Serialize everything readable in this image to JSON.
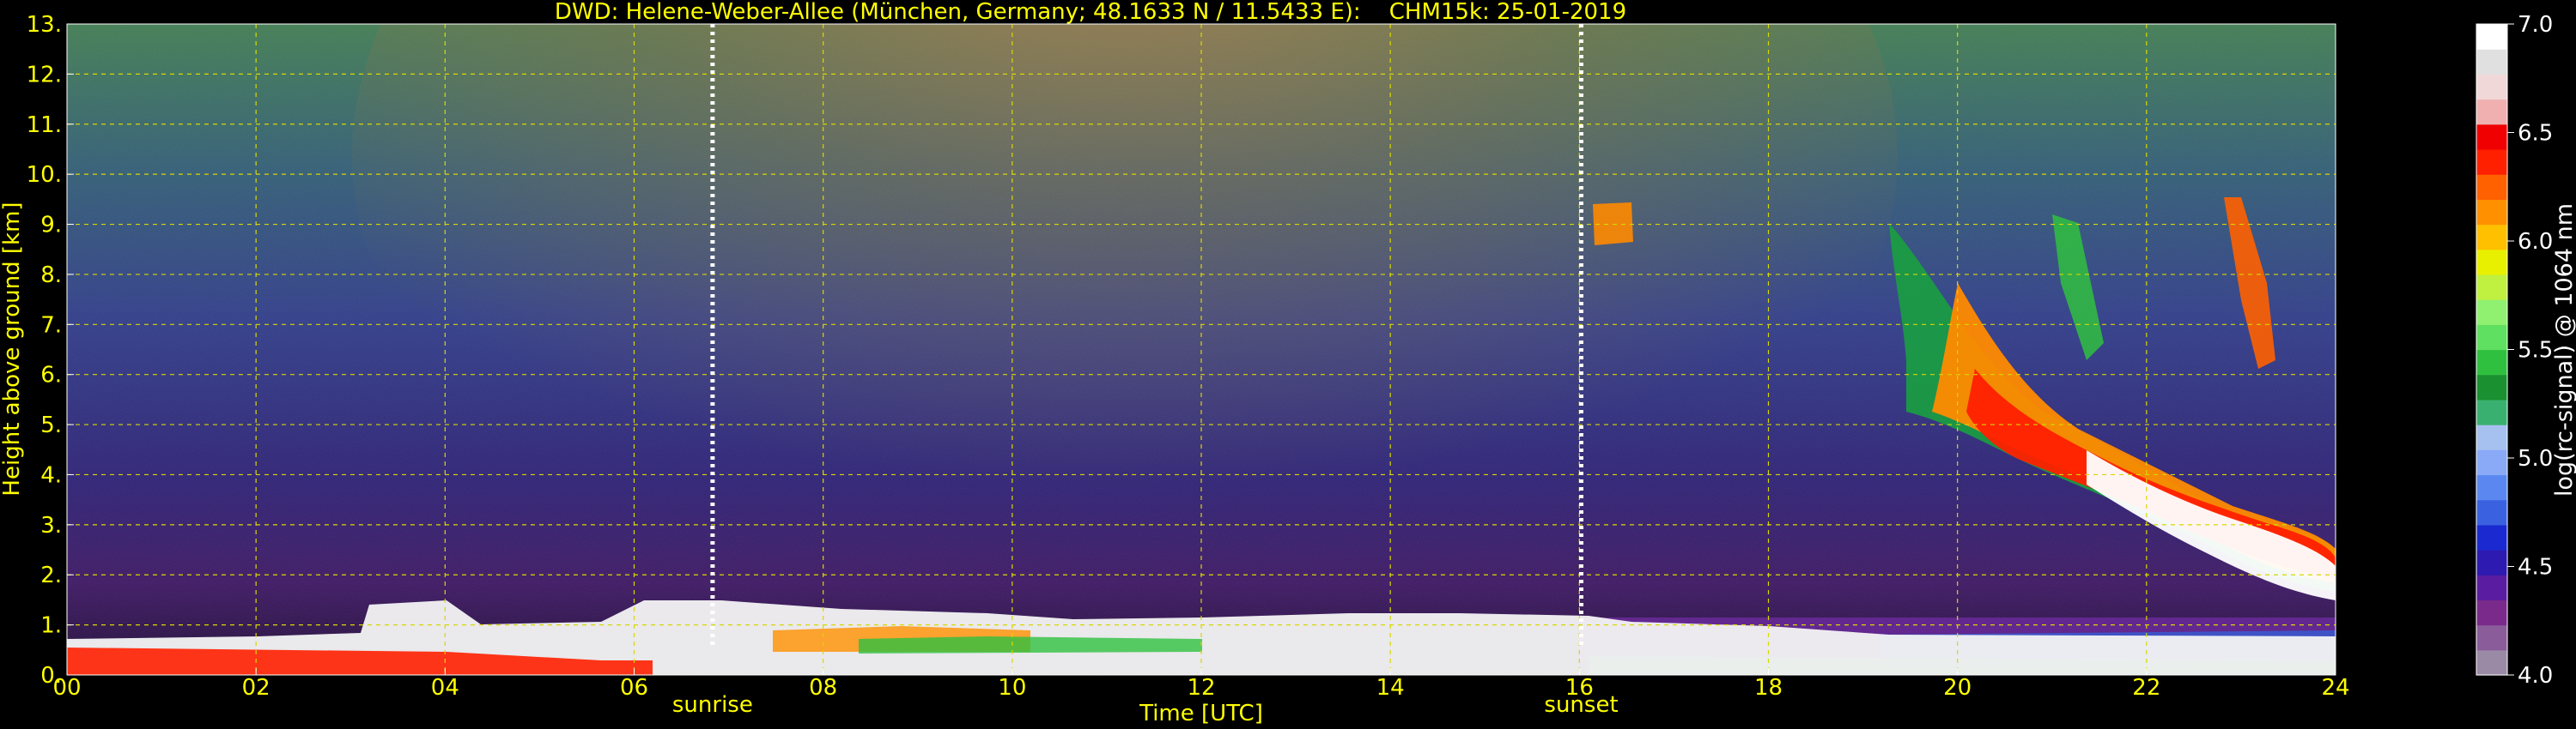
{
  "chart_data": {
    "type": "heatmap",
    "title": "DWD: Helene-Weber-Allee (München, Germany; 48.1633 N / 11.5433 E):    CHM15k: 25-01-2019",
    "xlabel": "Time [UTC]",
    "ylabel": "Height above ground [km]",
    "xlim": [
      0,
      24
    ],
    "ylim": [
      0,
      13
    ],
    "xticks": [
      "00",
      "02",
      "04",
      "06",
      "08",
      "10",
      "12",
      "14",
      "16",
      "18",
      "20",
      "22",
      "24"
    ],
    "yticks": [
      "0.",
      "1.",
      "2.",
      "3.",
      "4.",
      "5.",
      "6.",
      "7.",
      "8.",
      "9.",
      "10.",
      "11.",
      "12.",
      "13."
    ],
    "grid": true,
    "markers": [
      {
        "label": "sunrise",
        "x": 6.83
      },
      {
        "label": "sunset",
        "x": 16.02
      }
    ],
    "colorbar": {
      "label": "log(rc-signal) @ 1064 nm",
      "range": [
        4.0,
        7.0
      ],
      "ticks": [
        "4.0",
        "4.5",
        "5.0",
        "5.5",
        "6.0",
        "6.5",
        "7.0"
      ],
      "colors": [
        "#9a8aa6",
        "#8a5c9a",
        "#7a2a8a",
        "#5a1ca0",
        "#2d1ab0",
        "#1a2ad0",
        "#3a62e0",
        "#5a88f0",
        "#8aaaf8",
        "#a6c0f0",
        "#3ab070",
        "#1a9030",
        "#30c040",
        "#60e060",
        "#90f070",
        "#c0f040",
        "#e8f000",
        "#ffc000",
        "#ff9000",
        "#ff6000",
        "#ff2000",
        "#f00000",
        "#f0b0b0",
        "#f0d8d8",
        "#e0e0e0",
        "#ffffff"
      ]
    },
    "features": [
      {
        "name": "boundary layer",
        "x": [
          0,
          24
        ],
        "height_km": [
          0.5,
          1.3
        ]
      },
      {
        "name": "cloud",
        "x": [
          19.0,
          24.0
        ],
        "height_km": [
          1.5,
          8.0
        ]
      },
      {
        "name": "cirrus",
        "x": [
          16.0,
          16.6
        ],
        "height_km": [
          8.7,
          9.3
        ]
      }
    ]
  },
  "colors": {
    "text": "#ffff00",
    "grid": "#d8d800",
    "background": "#000000"
  }
}
